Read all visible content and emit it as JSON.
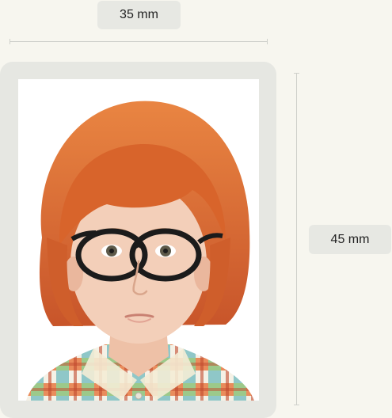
{
  "dimensions": {
    "width_label": "35 mm",
    "height_label": "45 mm"
  },
  "photo": {
    "subject": "child-portrait",
    "colors": {
      "background": "#ffffff",
      "hair": "#d8642b",
      "skin": "#f3cfb9",
      "glasses": "#1b1b1b"
    }
  },
  "colors": {
    "page_background": "#f7f6ef",
    "frame": "#e6e7e2",
    "label_background": "#e7e8e3",
    "guide_line": "#cfd0cb"
  }
}
